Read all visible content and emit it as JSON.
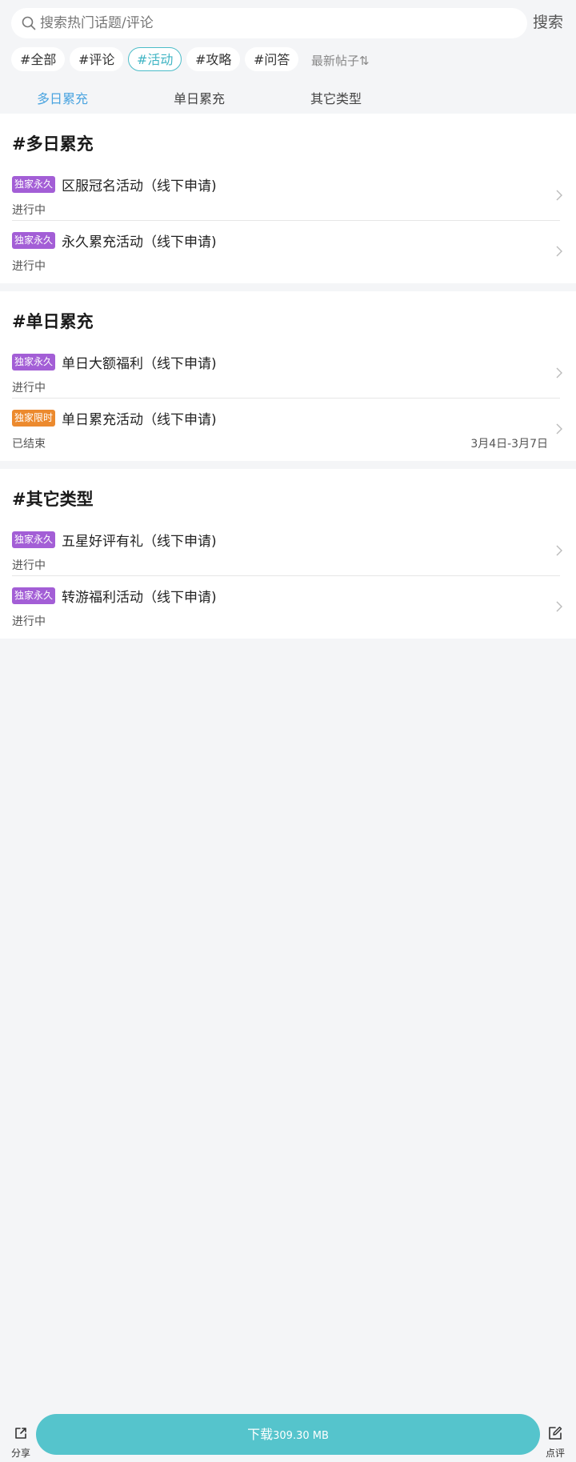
{
  "search": {
    "placeholder": "搜索热门话题/评论",
    "button_label": "搜索"
  },
  "chips": [
    {
      "label": "#全部",
      "active": false
    },
    {
      "label": "#评论",
      "active": false
    },
    {
      "label": "#活动",
      "active": true
    },
    {
      "label": "#攻略",
      "active": false
    },
    {
      "label": "#问答",
      "active": false
    }
  ],
  "sort": {
    "label": "最新帖子⇅"
  },
  "tabs": [
    {
      "label": "多日累充",
      "active": true
    },
    {
      "label": "单日累充",
      "active": false
    },
    {
      "label": "其它类型",
      "active": false
    }
  ],
  "sections": [
    {
      "title": "#多日累充",
      "items": [
        {
          "badge": "独家永久",
          "badge_color": "#a35ed6",
          "title": "区服冠名活动（线下申请)",
          "status": "进行中",
          "dates": ""
        },
        {
          "badge": "独家永久",
          "badge_color": "#a35ed6",
          "title": "永久累充活动（线下申请)",
          "status": "进行中",
          "dates": ""
        }
      ]
    },
    {
      "title": "#单日累充",
      "items": [
        {
          "badge": "独家永久",
          "badge_color": "#a35ed6",
          "title": "单日大额福利（线下申请)",
          "status": "进行中",
          "dates": ""
        },
        {
          "badge": "独家限时",
          "badge_color": "#ec8a2e",
          "title": "单日累充活动（线下申请)",
          "status": "已结束",
          "dates": "3月4日-3月7日"
        }
      ]
    },
    {
      "title": "#其它类型",
      "items": [
        {
          "badge": "独家永久",
          "badge_color": "#a35ed6",
          "title": "五星好评有礼（线下申请)",
          "status": "进行中",
          "dates": ""
        },
        {
          "badge": "独家永久",
          "badge_color": "#a35ed6",
          "title": "转游福利活动（线下申请)",
          "status": "进行中",
          "dates": ""
        }
      ]
    }
  ],
  "bottom": {
    "share_label": "分享",
    "share_icon": "share-icon",
    "download_label": "下载",
    "download_size": "309.30 MB",
    "review_label": "点评",
    "review_icon": "edit-icon"
  },
  "colors": {
    "accent": "#41b5c4",
    "tab_active": "#4aa4e0",
    "download_bg": "#55c4cc"
  }
}
